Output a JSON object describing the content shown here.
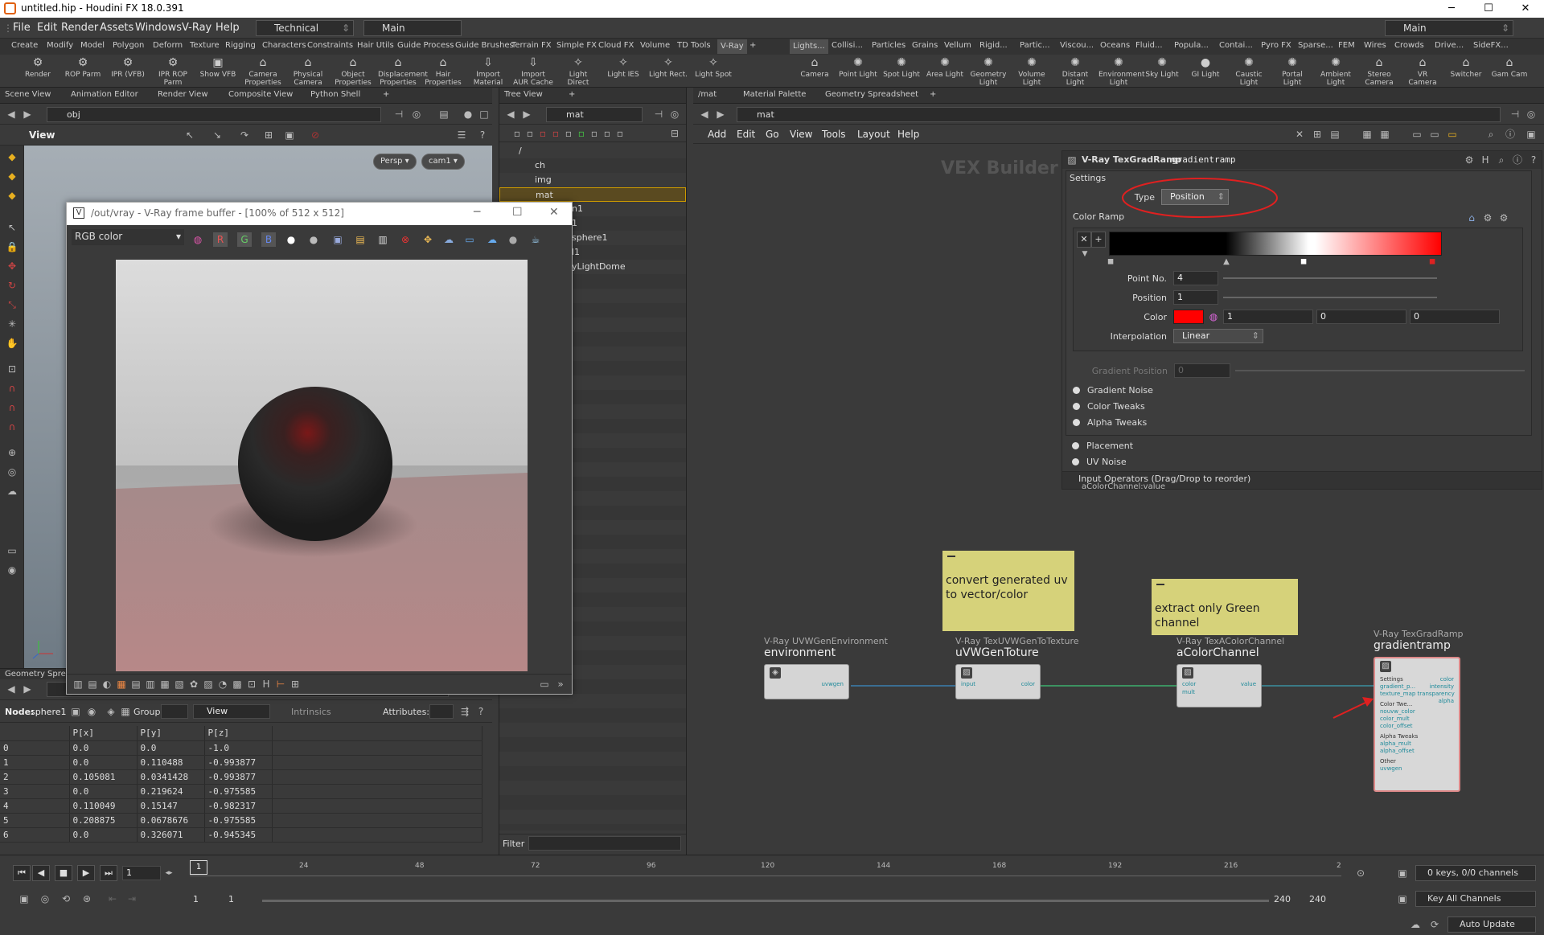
{
  "window": {
    "title": "untitled.hip - Houdini FX 18.0.391",
    "min": "─",
    "max": "☐",
    "close": "✕"
  },
  "menubar": {
    "items": [
      "File",
      "Edit",
      "Render",
      "Assets",
      "Windows",
      "V-Ray",
      "Help"
    ],
    "desktop": "Technical",
    "context": "Main",
    "right_context": "Main"
  },
  "shelf_tabs_left": [
    "Create",
    "Modify",
    "Model",
    "Polygon",
    "Deform",
    "Texture",
    "Rigging",
    "Characters",
    "Constraints",
    "Hair Utils",
    "Guide Process",
    "Guide Brushes",
    "Terrain FX",
    "Simple FX",
    "Cloud FX",
    "Volume",
    "TD Tools",
    "V-Ray"
  ],
  "shelf_tabs_right": [
    "Lights...",
    "Collisi...",
    "Particles",
    "Grains",
    "Vellum",
    "Rigid...",
    "Partic...",
    "Viscou...",
    "Oceans",
    "Fluid...",
    "Popula...",
    "Contai...",
    "Pyro FX",
    "Sparse...",
    "FEM",
    "Wires",
    "Crowds",
    "Drive...",
    "SideFX..."
  ],
  "shelf_tools_left": [
    {
      "label": "Render",
      "icon": "⚙"
    },
    {
      "label": "ROP Parm",
      "icon": "⚙"
    },
    {
      "label": "IPR (VFB)",
      "icon": "⚙"
    },
    {
      "label": "IPR ROP Parm",
      "icon": "⚙"
    },
    {
      "label": "Show VFB",
      "icon": "▣"
    },
    {
      "label": "Camera Properties",
      "icon": "⌂"
    },
    {
      "label": "Physical Camera",
      "icon": "⌂"
    },
    {
      "label": "Object Properties",
      "icon": "⌂"
    },
    {
      "label": "Displacement Properties",
      "icon": "⌂"
    },
    {
      "label": "Hair Properties",
      "icon": "⌂"
    },
    {
      "label": "Import Material",
      "icon": "⇩"
    },
    {
      "label": "Import AUR Cache",
      "icon": "⇩"
    },
    {
      "label": "Light Direct",
      "icon": "✧"
    },
    {
      "label": "Light IES",
      "icon": "✧"
    },
    {
      "label": "Light Rect.",
      "icon": "✧"
    },
    {
      "label": "Light Spot",
      "icon": "✧"
    }
  ],
  "shelf_tools_right": [
    {
      "label": "Camera",
      "icon": "⌂"
    },
    {
      "label": "Point Light",
      "icon": "✺"
    },
    {
      "label": "Spot Light",
      "icon": "✺"
    },
    {
      "label": "Area Light",
      "icon": "✺"
    },
    {
      "label": "Geometry Light",
      "icon": "✺"
    },
    {
      "label": "Volume Light",
      "icon": "✺"
    },
    {
      "label": "Distant Light",
      "icon": "✺"
    },
    {
      "label": "Environment Light",
      "icon": "✺"
    },
    {
      "label": "Sky Light",
      "icon": "✺"
    },
    {
      "label": "GI Light",
      "icon": "●"
    },
    {
      "label": "Caustic Light",
      "icon": "✺"
    },
    {
      "label": "Portal Light",
      "icon": "✺"
    },
    {
      "label": "Ambient Light",
      "icon": "✺"
    },
    {
      "label": "Stereo Camera",
      "icon": "⌂"
    },
    {
      "label": "VR Camera",
      "icon": "⌂"
    },
    {
      "label": "Switcher",
      "icon": "⌂"
    },
    {
      "label": "Gam Cam",
      "icon": "⌂"
    }
  ],
  "scene_view": {
    "tabs": [
      "Scene View",
      "Animation Editor",
      "Render View",
      "Composite View",
      "Python Shell"
    ],
    "path": "obj",
    "header": "View",
    "persp": "Persp",
    "cam": "cam1"
  },
  "vfb": {
    "title": "/out/vray - V-Ray frame buffer - [100% of 512 x 512]",
    "channel": "RGB color",
    "r": "R",
    "g": "G",
    "b": "B"
  },
  "tree_view": {
    "tabs": [
      "Tree View"
    ],
    "path": "mat",
    "items": [
      "/",
      "ch",
      "img",
      "mat",
      "n1",
      "1",
      "sphere1",
      "l1",
      "yLightDome"
    ],
    "filter_label": "Filter"
  },
  "spreadsheet": {
    "tab": "Geometry Spread",
    "path": "mat",
    "node_label": "Node:",
    "node": "sphere1",
    "group_label": "Group:",
    "view": "View",
    "intrinsics": "Intrinsics",
    "attributes_label": "Attributes:",
    "columns": [
      "",
      "P[x]",
      "P[y]",
      "P[z]"
    ],
    "rows": [
      [
        "0",
        "0.0",
        "0.0",
        "-1.0"
      ],
      [
        "1",
        "0.0",
        "0.110488",
        "-0.993877"
      ],
      [
        "2",
        "0.105081",
        "0.0341428",
        "-0.993877"
      ],
      [
        "3",
        "0.0",
        "0.219624",
        "-0.975585"
      ],
      [
        "4",
        "0.110049",
        "0.15147",
        "-0.982317"
      ],
      [
        "5",
        "0.208875",
        "0.0678676",
        "-0.975585"
      ],
      [
        "6",
        "0.0",
        "0.326071",
        "-0.945345"
      ]
    ]
  },
  "network": {
    "tabs": [
      "/mat",
      "Material Palette",
      "Geometry Spreadsheet"
    ],
    "path": "mat",
    "menu": [
      "Add",
      "Edit",
      "Go",
      "View",
      "Tools",
      "Layout",
      "Help"
    ],
    "watermark": "VEX Builder",
    "stickies": [
      {
        "text": "convert generated uv to vector/color"
      },
      {
        "text": "extract only Green channel"
      }
    ],
    "nodes": [
      {
        "type": "V-Ray UVWGenEnvironment",
        "name": "environment",
        "out": "uvwgen"
      },
      {
        "type": "V-Ray TexUVWGenToTexture",
        "name": "uVWGenToture",
        "in": "input",
        "out": "color"
      },
      {
        "type": "V-Ray TexAColorChannel",
        "name": "aColorChannel",
        "in1": "color",
        "in2": "mult",
        "out": "value"
      },
      {
        "type": "V-Ray TexGradRamp",
        "name": "gradientramp"
      }
    ],
    "gradientramp_ports": {
      "section1": "Settings",
      "p1": "gradient_p...",
      "p2": "texture_map transparency",
      "section2": "Color Twe...",
      "p3": "nouvw_color",
      "p4": "color_mult",
      "p5": "color_offset",
      "section3": "Alpha Tweaks",
      "p6": "alpha_mult",
      "p7": "alpha_offset",
      "section4": "Other",
      "p8": "uvwgen",
      "o1": "color",
      "o2": "intensity",
      "o3": "alpha"
    }
  },
  "params": {
    "optype": "V-Ray TexGradRamp",
    "name": "gradientramp",
    "settings": "Settings",
    "type_label": "Type",
    "type_value": "Position",
    "color_ramp": "Color Ramp",
    "point_no_label": "Point No.",
    "point_no": "4",
    "position_label": "Position",
    "position": "1",
    "color_label": "Color",
    "color_r": "1",
    "color_g": "0",
    "color_b": "0",
    "interp_label": "Interpolation",
    "interp": "Linear",
    "grad_pos_label": "Gradient Position",
    "grad_pos": "0",
    "folders": [
      "Gradient Noise",
      "Color Tweaks",
      "Alpha Tweaks",
      "Placement",
      "UV Noise"
    ],
    "input_ops": "Input Operators (Drag/Drop to reorder)",
    "input_item": "aColorChannel:value",
    "ramp_color": "#ff0000"
  },
  "timeline": {
    "ticks": [
      "24",
      "48",
      "72",
      "96",
      "120",
      "144",
      "168",
      "192",
      "216",
      "2"
    ],
    "frame": "1",
    "current": "1",
    "start": "1",
    "start2": "1",
    "end": "240",
    "end2": "240",
    "keys": "0 keys, 0/0 channels",
    "key_all": "Key All Channels",
    "auto_update": "Auto Update"
  }
}
